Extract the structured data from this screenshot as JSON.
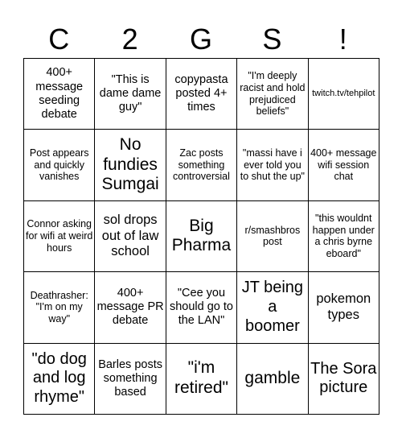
{
  "header": {
    "letters": [
      "C",
      "2",
      "G",
      "S",
      "!"
    ]
  },
  "cells": [
    [
      "400+ message seeding debate",
      "\"This is dame dame guy\"",
      "copypasta posted 4+ times",
      "\"I'm deeply racist and hold prejudiced beliefs\"",
      "twitch.tv/tehpilot"
    ],
    [
      "Post appears and quickly vanishes",
      "No fundies Sumgai",
      "Zac posts something controversial",
      "\"massi have i ever told you to shut the up\"",
      "400+ message wifi session chat"
    ],
    [
      "Connor asking for wifi at weird hours",
      "sol drops out of law school",
      "Big Pharma",
      "r/smashbros post",
      "\"this wouldnt happen under a chris byrne eboard\""
    ],
    [
      "Deathrasher: \"I'm on my way\"",
      "400+ message PR debate",
      "\"Cee you should go to the LAN\"",
      "JT being a boomer",
      "pokemon types"
    ],
    [
      "\"do dog and log rhyme\"",
      "Barles posts something based",
      "\"i'm retired\"",
      "gamble",
      "The Sora picture"
    ]
  ]
}
